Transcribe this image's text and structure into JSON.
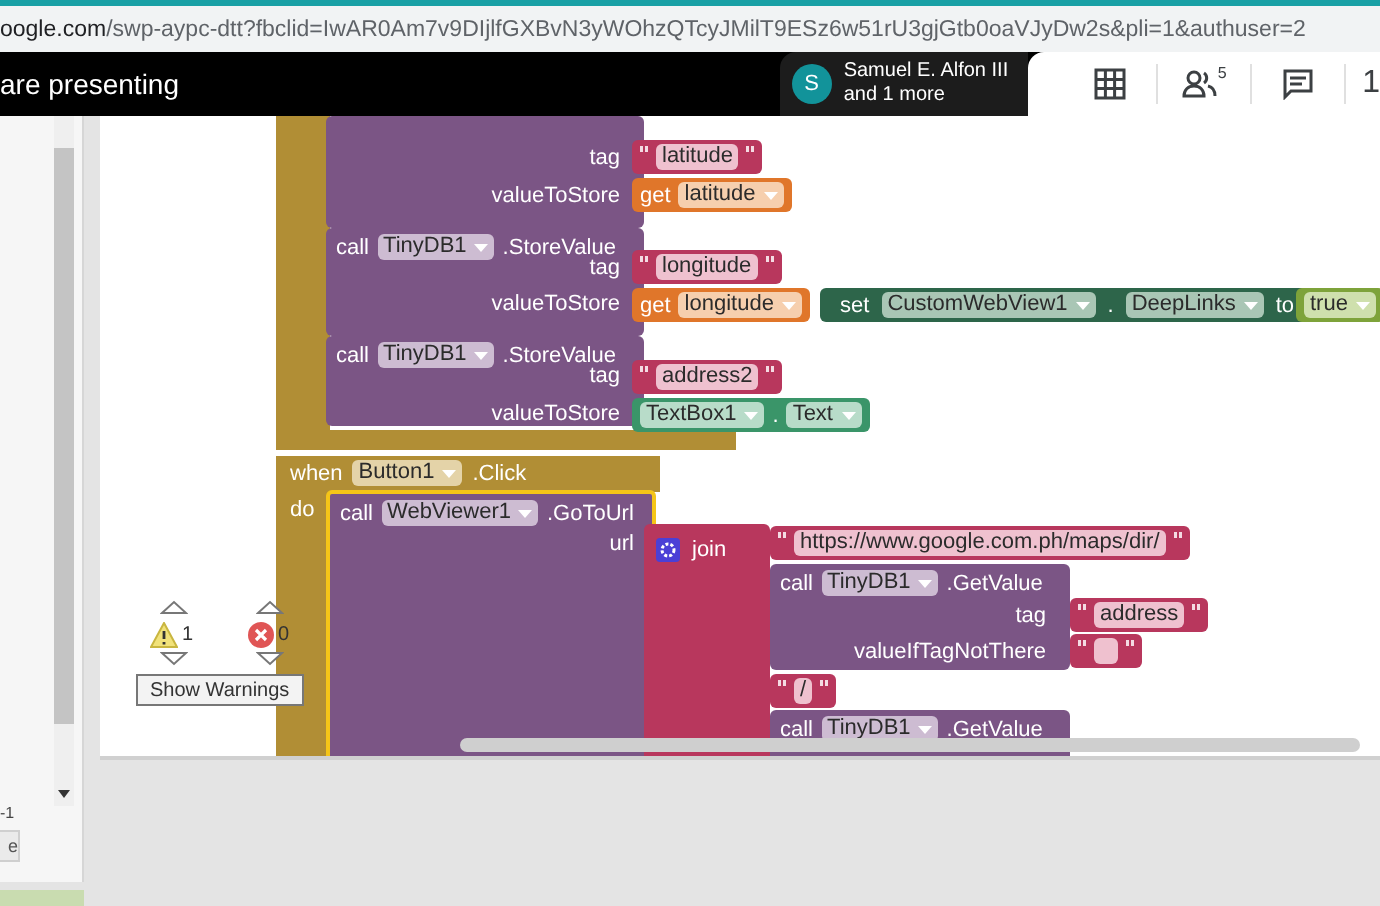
{
  "address_bar": {
    "domain": "oogle.com",
    "path": "/swp-aypc-dtt?fbclid=IwAR0Am7v9DIjlfGXBvN3yWOhzQTcyJMilT9ESz6w51rU3gjGtb0oaVJyDw2s&pli=1&authuser=2"
  },
  "meeting_bar": {
    "status": "are presenting",
    "avatar_initial": "S",
    "presenter": "Samuel E. Alfon III",
    "others": "and 1 more",
    "people_count": "5",
    "clock": "1"
  },
  "side_panel": {
    "text": "-1",
    "button": "e"
  },
  "blocks": [
    {
      "kind": "event_body"
    },
    {
      "kind": "call_body"
    },
    {
      "kind": "label",
      "text": "tag"
    },
    {
      "kind": "text",
      "value": "latitude"
    },
    {
      "kind": "label",
      "text": "valueToStore"
    },
    {
      "kind": "get",
      "keyword": "get",
      "variable": "latitude"
    },
    {
      "kind": "call",
      "keyword": "call",
      "component": "TinyDB1",
      "method": ".StoreValue",
      "selected": false
    },
    {
      "kind": "label",
      "text": "tag"
    },
    {
      "kind": "text",
      "value": "longitude"
    },
    {
      "kind": "label",
      "text": "valueToStore"
    },
    {
      "kind": "get",
      "keyword": "get",
      "variable": "longitude"
    },
    {
      "kind": "set",
      "keyword": "set",
      "component": "CustomWebView1",
      "separator": ".",
      "property": "DeepLinks",
      "to": "to"
    },
    {
      "kind": "logic",
      "value": "true"
    },
    {
      "kind": "call",
      "keyword": "call",
      "component": "TinyDB1",
      "method": ".StoreValue",
      "selected": false
    },
    {
      "kind": "label",
      "text": "tag"
    },
    {
      "kind": "text",
      "value": "address2"
    },
    {
      "kind": "label",
      "text": "valueToStore"
    },
    {
      "kind": "property",
      "component": "TextBox1",
      "separator": ".",
      "property": "Text"
    },
    {
      "kind": "event",
      "keyword": "when",
      "component": "Button1",
      "event": ".Click",
      "do": "do"
    },
    {
      "kind": "call",
      "keyword": "call",
      "component": "WebViewer1",
      "method": ".GoToUrl",
      "selected": true
    },
    {
      "kind": "label",
      "text": "url"
    },
    {
      "kind": "join",
      "keyword": "join"
    },
    {
      "kind": "text",
      "value": "https://www.google.com.ph/maps/dir/"
    },
    {
      "kind": "call",
      "keyword": "call",
      "component": "TinyDB1",
      "method": ".GetValue",
      "selected": false
    },
    {
      "kind": "label",
      "text": "tag"
    },
    {
      "kind": "text",
      "value": "address"
    },
    {
      "kind": "label",
      "text": "valueIfTagNotThere"
    },
    {
      "kind": "empty_text"
    },
    {
      "kind": "text",
      "value": "/"
    },
    {
      "kind": "call",
      "keyword": "call",
      "component": "TinyDB1",
      "method": ".GetValue",
      "selected": false
    }
  ],
  "warnings": {
    "warning_count": "1",
    "error_count": "0",
    "button": "Show Warnings"
  }
}
